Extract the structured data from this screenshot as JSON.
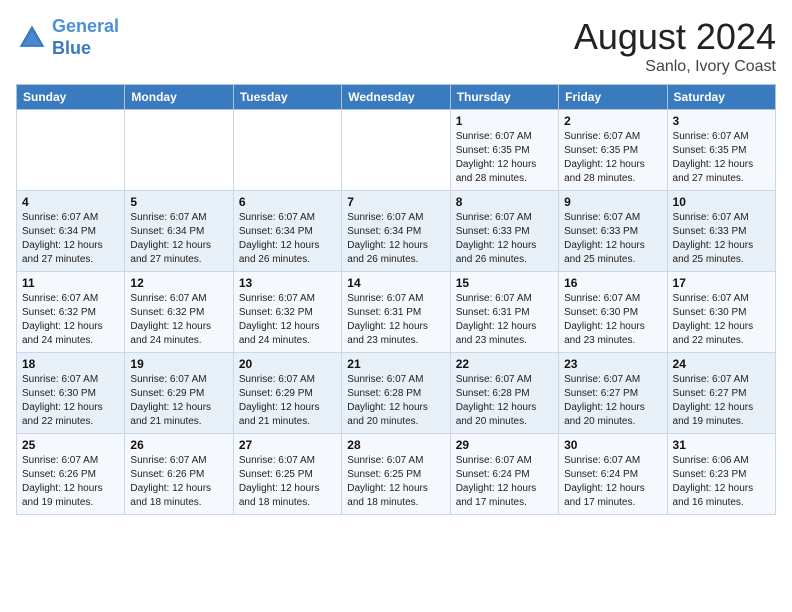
{
  "header": {
    "logo_line1": "General",
    "logo_line2": "Blue",
    "main_title": "August 2024",
    "subtitle": "Sanlo, Ivory Coast"
  },
  "days_of_week": [
    "Sunday",
    "Monday",
    "Tuesday",
    "Wednesday",
    "Thursday",
    "Friday",
    "Saturday"
  ],
  "weeks": [
    {
      "days": [
        {
          "number": "",
          "info": ""
        },
        {
          "number": "",
          "info": ""
        },
        {
          "number": "",
          "info": ""
        },
        {
          "number": "",
          "info": ""
        },
        {
          "number": "1",
          "info": "Sunrise: 6:07 AM\nSunset: 6:35 PM\nDaylight: 12 hours\nand 28 minutes."
        },
        {
          "number": "2",
          "info": "Sunrise: 6:07 AM\nSunset: 6:35 PM\nDaylight: 12 hours\nand 28 minutes."
        },
        {
          "number": "3",
          "info": "Sunrise: 6:07 AM\nSunset: 6:35 PM\nDaylight: 12 hours\nand 27 minutes."
        }
      ]
    },
    {
      "days": [
        {
          "number": "4",
          "info": "Sunrise: 6:07 AM\nSunset: 6:34 PM\nDaylight: 12 hours\nand 27 minutes."
        },
        {
          "number": "5",
          "info": "Sunrise: 6:07 AM\nSunset: 6:34 PM\nDaylight: 12 hours\nand 27 minutes."
        },
        {
          "number": "6",
          "info": "Sunrise: 6:07 AM\nSunset: 6:34 PM\nDaylight: 12 hours\nand 26 minutes."
        },
        {
          "number": "7",
          "info": "Sunrise: 6:07 AM\nSunset: 6:34 PM\nDaylight: 12 hours\nand 26 minutes."
        },
        {
          "number": "8",
          "info": "Sunrise: 6:07 AM\nSunset: 6:33 PM\nDaylight: 12 hours\nand 26 minutes."
        },
        {
          "number": "9",
          "info": "Sunrise: 6:07 AM\nSunset: 6:33 PM\nDaylight: 12 hours\nand 25 minutes."
        },
        {
          "number": "10",
          "info": "Sunrise: 6:07 AM\nSunset: 6:33 PM\nDaylight: 12 hours\nand 25 minutes."
        }
      ]
    },
    {
      "days": [
        {
          "number": "11",
          "info": "Sunrise: 6:07 AM\nSunset: 6:32 PM\nDaylight: 12 hours\nand 24 minutes."
        },
        {
          "number": "12",
          "info": "Sunrise: 6:07 AM\nSunset: 6:32 PM\nDaylight: 12 hours\nand 24 minutes."
        },
        {
          "number": "13",
          "info": "Sunrise: 6:07 AM\nSunset: 6:32 PM\nDaylight: 12 hours\nand 24 minutes."
        },
        {
          "number": "14",
          "info": "Sunrise: 6:07 AM\nSunset: 6:31 PM\nDaylight: 12 hours\nand 23 minutes."
        },
        {
          "number": "15",
          "info": "Sunrise: 6:07 AM\nSunset: 6:31 PM\nDaylight: 12 hours\nand 23 minutes."
        },
        {
          "number": "16",
          "info": "Sunrise: 6:07 AM\nSunset: 6:30 PM\nDaylight: 12 hours\nand 23 minutes."
        },
        {
          "number": "17",
          "info": "Sunrise: 6:07 AM\nSunset: 6:30 PM\nDaylight: 12 hours\nand 22 minutes."
        }
      ]
    },
    {
      "days": [
        {
          "number": "18",
          "info": "Sunrise: 6:07 AM\nSunset: 6:30 PM\nDaylight: 12 hours\nand 22 minutes."
        },
        {
          "number": "19",
          "info": "Sunrise: 6:07 AM\nSunset: 6:29 PM\nDaylight: 12 hours\nand 21 minutes."
        },
        {
          "number": "20",
          "info": "Sunrise: 6:07 AM\nSunset: 6:29 PM\nDaylight: 12 hours\nand 21 minutes."
        },
        {
          "number": "21",
          "info": "Sunrise: 6:07 AM\nSunset: 6:28 PM\nDaylight: 12 hours\nand 20 minutes."
        },
        {
          "number": "22",
          "info": "Sunrise: 6:07 AM\nSunset: 6:28 PM\nDaylight: 12 hours\nand 20 minutes."
        },
        {
          "number": "23",
          "info": "Sunrise: 6:07 AM\nSunset: 6:27 PM\nDaylight: 12 hours\nand 20 minutes."
        },
        {
          "number": "24",
          "info": "Sunrise: 6:07 AM\nSunset: 6:27 PM\nDaylight: 12 hours\nand 19 minutes."
        }
      ]
    },
    {
      "days": [
        {
          "number": "25",
          "info": "Sunrise: 6:07 AM\nSunset: 6:26 PM\nDaylight: 12 hours\nand 19 minutes."
        },
        {
          "number": "26",
          "info": "Sunrise: 6:07 AM\nSunset: 6:26 PM\nDaylight: 12 hours\nand 18 minutes."
        },
        {
          "number": "27",
          "info": "Sunrise: 6:07 AM\nSunset: 6:25 PM\nDaylight: 12 hours\nand 18 minutes."
        },
        {
          "number": "28",
          "info": "Sunrise: 6:07 AM\nSunset: 6:25 PM\nDaylight: 12 hours\nand 18 minutes."
        },
        {
          "number": "29",
          "info": "Sunrise: 6:07 AM\nSunset: 6:24 PM\nDaylight: 12 hours\nand 17 minutes."
        },
        {
          "number": "30",
          "info": "Sunrise: 6:07 AM\nSunset: 6:24 PM\nDaylight: 12 hours\nand 17 minutes."
        },
        {
          "number": "31",
          "info": "Sunrise: 6:06 AM\nSunset: 6:23 PM\nDaylight: 12 hours\nand 16 minutes."
        }
      ]
    }
  ]
}
